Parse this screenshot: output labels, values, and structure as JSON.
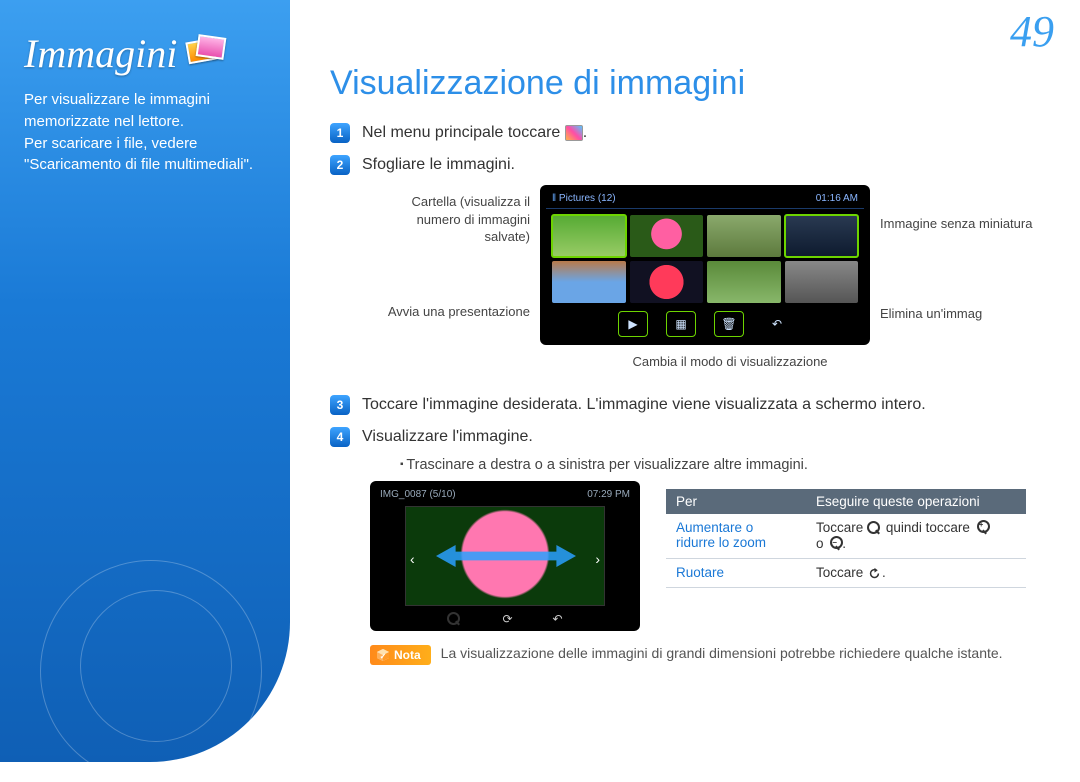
{
  "page_number": "49",
  "sidebar": {
    "title": "Immagini",
    "description": "Per visualizzare le immagini memorizzate nel lettore.\nPer scaricare i file, vedere \"Scaricamento di file multimediali\"."
  },
  "main": {
    "title": "Visualizzazione di immagini",
    "steps": {
      "1": "Nel menu principale toccare",
      "1_suffix": ".",
      "2": "Sfogliare le immagini.",
      "3": "Toccare l'immagine desiderata. L'immagine viene visualizzata a schermo intero.",
      "4": "Visualizzare l'immagine."
    },
    "bullet_4a": "Trascinare a destra o a sinistra per visualizzare altre immagini."
  },
  "device1": {
    "header_title": "Pictures (12)",
    "header_time": "01:16 AM"
  },
  "annotations": {
    "folder": "Cartella (visualizza il numero di immagini salvate)",
    "slideshow": "Avvia una presentazione",
    "no_thumb": "Immagine senza miniatura",
    "delete": "Elimina un'immag",
    "view_mode": "Cambia il modo di visualizzazione"
  },
  "device2": {
    "header_title": "IMG_0087 (5/10)",
    "header_time": "07:29 PM"
  },
  "table": {
    "header_per": "Per",
    "header_ops": "Eseguire queste operazioni",
    "row1_per": "Aumentare o ridurre lo zoom",
    "row1_ops_a": "Toccare",
    "row1_ops_b": "quindi toccare",
    "row1_ops_c": "o",
    "row2_per": "Ruotare",
    "row2_ops": "Toccare"
  },
  "note": {
    "badge": "Nota",
    "text": "La visualizzazione delle immagini di grandi dimensioni potrebbe richiedere qualche istante."
  }
}
